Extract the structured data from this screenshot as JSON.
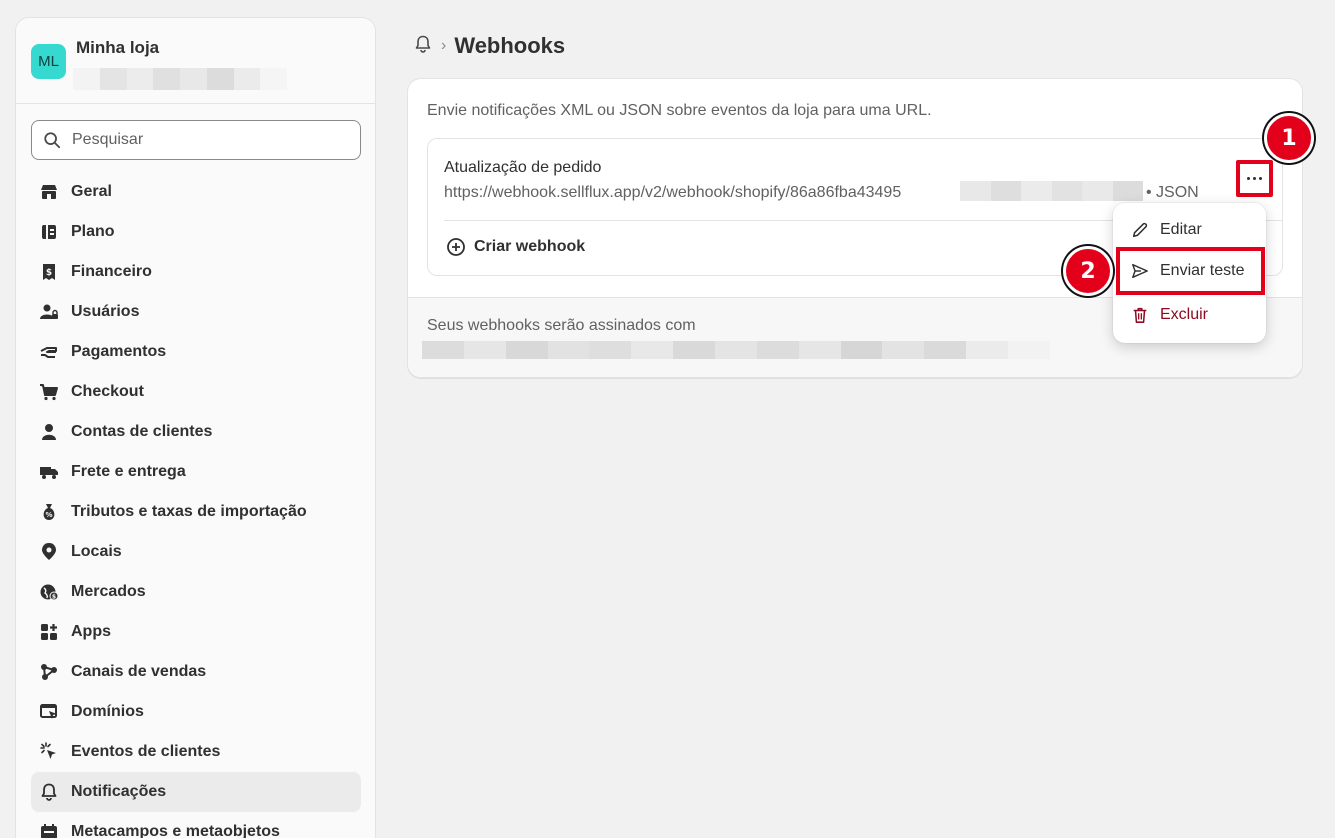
{
  "store": {
    "avatar_initials": "ML",
    "name": "Minha loja"
  },
  "search": {
    "placeholder": "Pesquisar"
  },
  "nav": {
    "items": [
      {
        "label": "Geral",
        "icon": "store-icon"
      },
      {
        "label": "Plano",
        "icon": "plan-icon"
      },
      {
        "label": "Financeiro",
        "icon": "receipt-icon"
      },
      {
        "label": "Usuários",
        "icon": "users-icon"
      },
      {
        "label": "Pagamentos",
        "icon": "payments-icon"
      },
      {
        "label": "Checkout",
        "icon": "cart-icon"
      },
      {
        "label": "Contas de clientes",
        "icon": "person-icon"
      },
      {
        "label": "Frete e entrega",
        "icon": "truck-icon"
      },
      {
        "label": "Tributos e taxas de importação",
        "icon": "tax-icon"
      },
      {
        "label": "Locais",
        "icon": "location-icon"
      },
      {
        "label": "Mercados",
        "icon": "globe-icon"
      },
      {
        "label": "Apps",
        "icon": "apps-icon"
      },
      {
        "label": "Canais de vendas",
        "icon": "channels-icon"
      },
      {
        "label": "Domínios",
        "icon": "domain-icon"
      },
      {
        "label": "Eventos de clientes",
        "icon": "cursor-icon"
      },
      {
        "label": "Notificações",
        "icon": "bell-icon",
        "active": true
      },
      {
        "label": "Metacampos e metaobjetos",
        "icon": "metafields-icon"
      }
    ]
  },
  "breadcrumb": {
    "separator": "›",
    "title": "Webhooks"
  },
  "card": {
    "description": "Envie notificações XML ou JSON sobre eventos da loja para uma URL.",
    "webhook": {
      "name": "Atualização de pedido",
      "url": "https://webhook.sellflux.app/v2/webhook/shopify/86a86fba43495",
      "format": "• JSON"
    },
    "create_label": "Criar webhook",
    "footer_text": "Seus webhooks serão assinados com"
  },
  "menu": {
    "edit_label": "Editar",
    "send_test_label": "Enviar teste",
    "delete_label": "Excluir"
  },
  "annotations": {
    "step1": "1",
    "step2": "2"
  },
  "colors": {
    "highlight": "#e3001b",
    "avatar_bg": "#36d9d0",
    "danger": "#8e0b21"
  }
}
